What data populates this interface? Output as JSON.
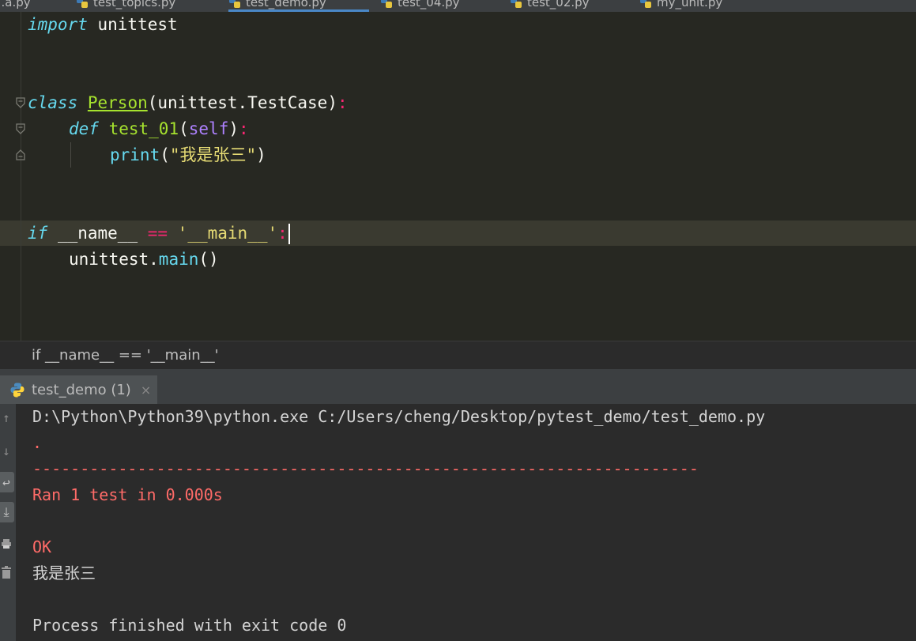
{
  "tabs": [
    {
      "label": "...a.py",
      "active": false
    },
    {
      "label": "test_topics.py",
      "active": false
    },
    {
      "label": "test_demo.py",
      "active": true
    },
    {
      "label": "test_04.py",
      "active": false
    },
    {
      "label": "test_02.py",
      "active": false
    },
    {
      "label": "my_unit.py",
      "active": false
    }
  ],
  "editor": {
    "line1": {
      "kw": "import",
      "rest": " unittest"
    },
    "line2": {
      "kw": "class",
      "name": "Person",
      "paren_open": "(",
      "base": "unittest.TestCase",
      "paren_close": ")",
      "colon": ":"
    },
    "line3": {
      "kw": "def",
      "name": "test_01",
      "paren_open": "(",
      "self": "self",
      "paren_close": ")",
      "colon": ":"
    },
    "line4": {
      "func": "print",
      "paren_open": "(",
      "string": "\"我是张三\"",
      "paren_close": ")"
    },
    "line5": {
      "kw": "if",
      "name": " __name__ ",
      "op": "==",
      "string": " '__main__'",
      "colon": ":"
    },
    "line6": {
      "obj": "unittest.",
      "meth": "main",
      "parens": "()"
    }
  },
  "breadcrumb": {
    "text": "if __name__ == '__main__'"
  },
  "run": {
    "tab_label": "test_demo (1)",
    "close_glyph": "×",
    "output": [
      {
        "text": "D:\\Python\\Python39\\python.exe C:/Users/cheng/Desktop/pytest_demo/test_demo.py",
        "kind": "normal"
      },
      {
        "text": ".",
        "kind": "err"
      },
      {
        "text": "----------------------------------------------------------------------",
        "kind": "err"
      },
      {
        "text": "Ran 1 test in 0.000s",
        "kind": "err"
      },
      {
        "text": "",
        "kind": "normal"
      },
      {
        "text": "OK",
        "kind": "err"
      },
      {
        "text": "我是张三",
        "kind": "normal"
      },
      {
        "text": "",
        "kind": "normal"
      },
      {
        "text": "Process finished with exit code 0",
        "kind": "normal"
      }
    ],
    "toolbar_icons": [
      "arrow-up-icon",
      "arrow-down-icon",
      "soft-wrap-icon",
      "scroll-to-end-icon",
      "print-icon",
      "trash-icon"
    ]
  },
  "colors": {
    "editor_bg": "#272822",
    "keyword": "#66d9ef",
    "class_name": "#a6e22e",
    "string": "#e6db74",
    "operator": "#f92672",
    "console_stderr": "#ff6b68"
  }
}
